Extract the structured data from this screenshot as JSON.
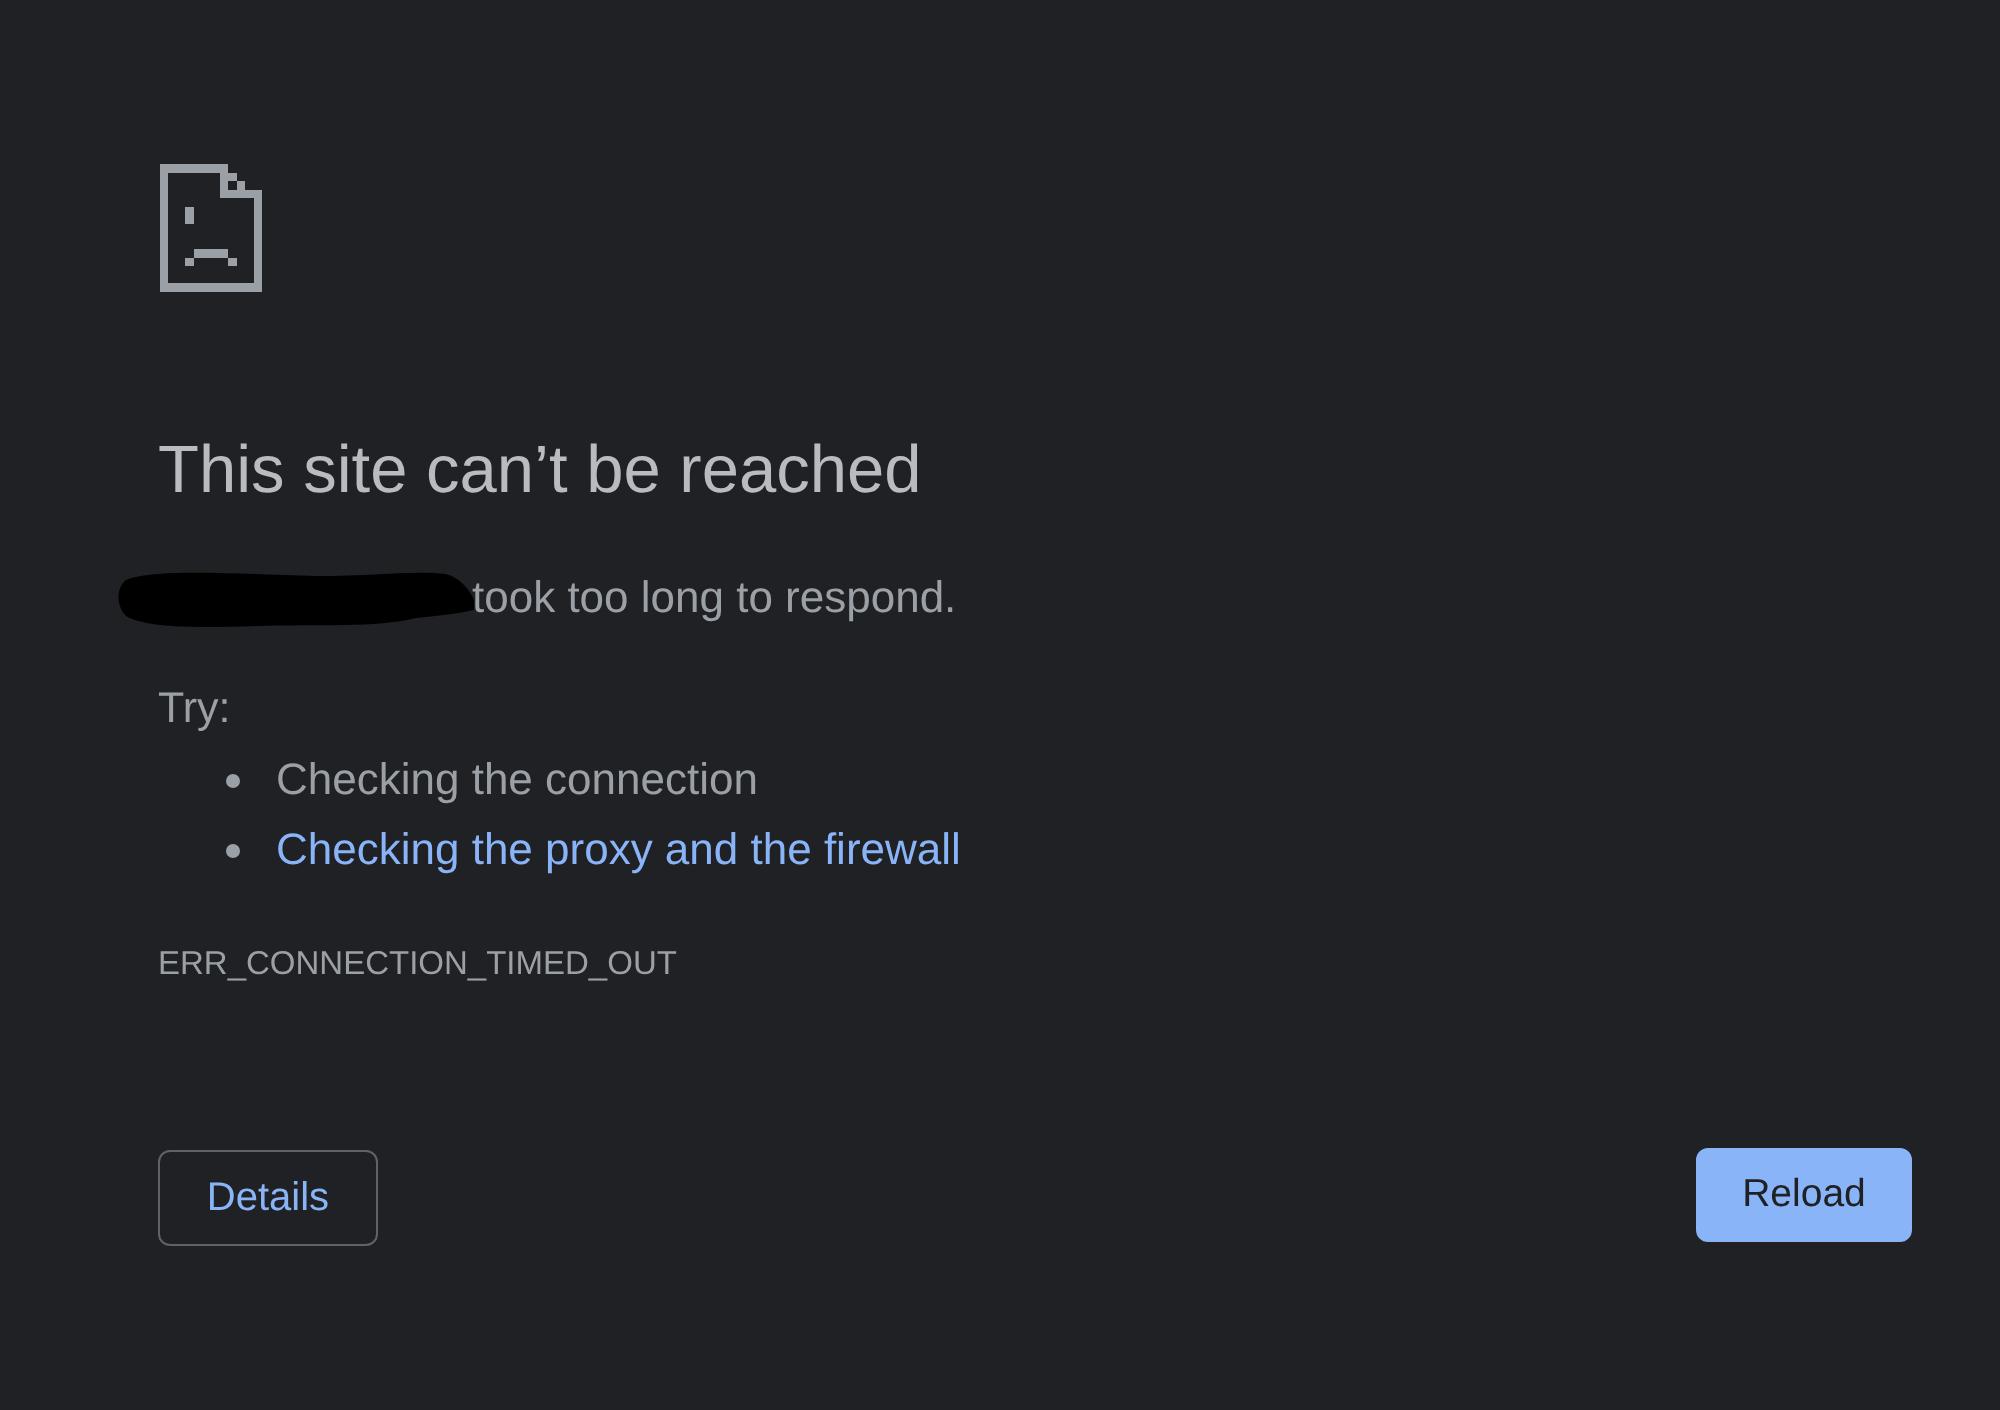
{
  "error_page": {
    "title": "This site can’t be reached",
    "message": "took too long to respond.",
    "try_label": "Try:",
    "suggestions": [
      {
        "text": "Checking the connection",
        "kind": "text"
      },
      {
        "text": "Checking the proxy and the firewall",
        "kind": "link"
      }
    ],
    "error_code": "ERR_CONNECTION_TIMED_OUT"
  },
  "buttons": [
    {
      "label": "Details",
      "kind": "secondary"
    },
    {
      "label": "Reload",
      "kind": "primary"
    }
  ]
}
